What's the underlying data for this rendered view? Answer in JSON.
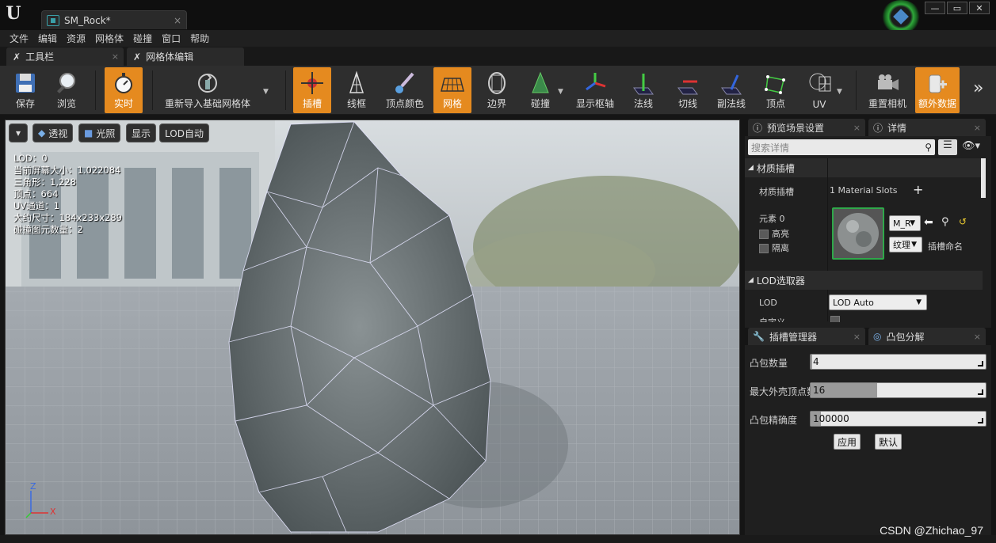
{
  "window": {
    "doc_tab": "SM_Rock*",
    "close": "×",
    "min": "—",
    "max": "▭",
    "winclose": "✕"
  },
  "menu": [
    "文件",
    "编辑",
    "资源",
    "网格体",
    "碰撞",
    "窗口",
    "帮助"
  ],
  "panel_tabs": [
    {
      "label": "工具栏"
    },
    {
      "label": "网格体编辑"
    }
  ],
  "toolbar": [
    {
      "label": "保存",
      "active": false
    },
    {
      "label": "浏览",
      "active": false
    },
    {
      "label": "实时",
      "active": true
    },
    {
      "label": "重新导入基础网格体",
      "active": false
    },
    {
      "label": "插槽",
      "active": true
    },
    {
      "label": "线框",
      "active": false
    },
    {
      "label": "顶点颜色",
      "active": false
    },
    {
      "label": "网格",
      "active": true
    },
    {
      "label": "边界",
      "active": false
    },
    {
      "label": "碰撞",
      "active": false
    },
    {
      "label": "显示枢轴",
      "active": false
    },
    {
      "label": "法线",
      "active": false
    },
    {
      "label": "切线",
      "active": false
    },
    {
      "label": "副法线",
      "active": false
    },
    {
      "label": "顶点",
      "active": false
    },
    {
      "label": "UV",
      "active": false
    },
    {
      "label": "重置相机",
      "active": false
    },
    {
      "label": "额外数据",
      "active": true
    }
  ],
  "viewport": {
    "dropdown": "▾",
    "perspective": "透视",
    "lighting": "光照",
    "show": "显示",
    "lod": "LOD自动",
    "stats": [
      "LOD：0",
      "当前屏幕大小：1.022084",
      "三角形：1,228",
      "顶点：664",
      "UV通道：1",
      "大约尺寸：184x233x289",
      "碰撞图元数量：2"
    ],
    "axis_z": "Z",
    "axis_x": "X"
  },
  "details": {
    "tab_preview": "预览场景设置",
    "tab_details": "详情",
    "search_placeholder": "搜索详情",
    "material_section": "材质插槽",
    "material_slots_label": "材质插槽",
    "material_slots_value": "1 Material Slots",
    "element_label": "元素 0",
    "highlight": "高亮",
    "isolate": "隔离",
    "material_name": "M_R",
    "texture": "纹理",
    "slot_name": "插槽命名",
    "lod_section": "LOD选取器",
    "lod_label": "LOD",
    "lod_value": "LOD Auto",
    "custom_label": "自定义"
  },
  "convex": {
    "tab_socket": "插槽管理器",
    "tab_convex": "凸包分解",
    "hull_count_label": "凸包数量",
    "hull_count": "4",
    "hull_count_fill": 0.01,
    "max_verts_label": "最大外壳顶点数",
    "max_verts": "16",
    "max_verts_fill": 0.38,
    "precision_label": "凸包精确度",
    "precision": "100000",
    "precision_fill": 0.06,
    "apply": "应用",
    "default": "默认"
  },
  "watermark": "CSDN @Zhichao_97",
  "colors": {
    "accent": "#e58a1f",
    "bg": "#1f1f1f",
    "panel": "#2e2e2e"
  }
}
